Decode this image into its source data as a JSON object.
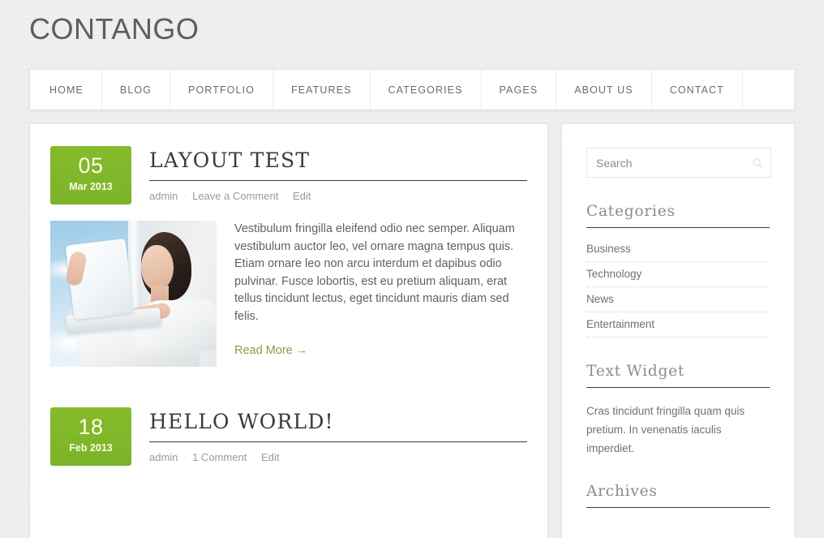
{
  "site": {
    "title": "CONTANGO"
  },
  "nav": {
    "items": [
      {
        "label": "HOME"
      },
      {
        "label": "BLOG"
      },
      {
        "label": "PORTFOLIO"
      },
      {
        "label": "FEATURES"
      },
      {
        "label": "CATEGORIES"
      },
      {
        "label": "PAGES"
      },
      {
        "label": "ABOUT US"
      },
      {
        "label": "CONTACT"
      }
    ]
  },
  "posts": [
    {
      "day": "05",
      "month_year": "Mar 2013",
      "title": "LAYOUT TEST",
      "author": "admin",
      "comments": "Leave a Comment",
      "edit": "Edit",
      "separator": "·",
      "thumb_alt": "woman-with-laptop-photo",
      "body": "Vestibulum fringilla eleifend odio nec semper. Aliquam vestibulum auctor leo, vel ornare magna tempus quis. Etiam ornare leo non arcu interdum et dapibus odio pulvinar. Fusce lobortis, est eu pretium aliquam, erat tellus tincidunt lectus, eget tincidunt mauris diam sed felis.",
      "read_more": "Read More →"
    },
    {
      "day": "18",
      "month_year": "Feb 2013",
      "title": "HELLO WORLD!",
      "author": "admin",
      "comments": "1 Comment",
      "edit": "Edit",
      "separator": "·"
    }
  ],
  "sidebar": {
    "search": {
      "placeholder": "Search",
      "value": "",
      "icon": "search-icon"
    },
    "categories": {
      "title": "Categories",
      "items": [
        {
          "label": "Business"
        },
        {
          "label": "Technology"
        },
        {
          "label": "News"
        },
        {
          "label": "Entertainment"
        }
      ]
    },
    "text_widget": {
      "title": "Text Widget",
      "body": "Cras tincidunt fringilla quam quis pretium. In venenatis iaculis imperdiet."
    },
    "archives": {
      "title": "Archives"
    }
  },
  "colors": {
    "accent_green": "#7db72b",
    "badge_green_top": "#85bb2c",
    "badge_green_bottom": "#7cb328",
    "link_olive": "#8a9b4f",
    "page_bg": "#e8e8e8",
    "card_bg": "#ffffff",
    "rule_dark": "#3c3c3c",
    "text_body": "#5f6263",
    "text_meta": "#9a9a9a",
    "widget_title": "#8b8b8b"
  }
}
